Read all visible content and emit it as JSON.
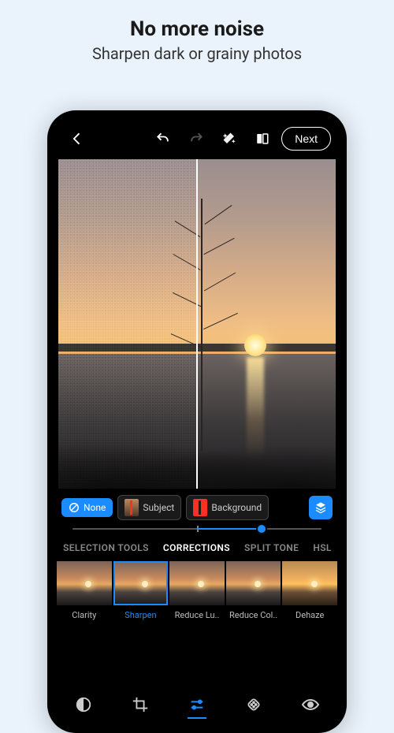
{
  "promo": {
    "title": "No more noise",
    "subtitle": "Sharpen dark or grainy photos"
  },
  "topbar": {
    "next_label": "Next"
  },
  "mask": {
    "none_label": "None",
    "subject_label": "Subject",
    "background_label": "Background"
  },
  "slider": {
    "value_pct": 76
  },
  "tabs": {
    "selection_tools": "SELECTION TOOLS",
    "corrections": "CORRECTIONS",
    "split_tone": "SPLIT TONE",
    "hsl": "HSL"
  },
  "presets": {
    "clarity": "Clarity",
    "sharpen": "Sharpen",
    "reduce_lum": "Reduce Lu..",
    "reduce_col": "Reduce Col..",
    "dehaze": "Dehaze"
  }
}
